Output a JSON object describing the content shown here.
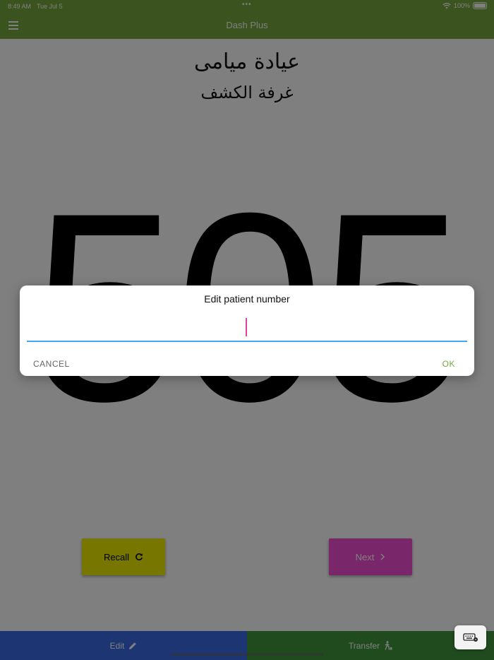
{
  "status_bar": {
    "time": "8:49 AM",
    "date": "Tue Jul 5",
    "dots": "•••",
    "battery": "100%"
  },
  "app_bar": {
    "title": "Dash Plus",
    "menu_icon": "hamburger-menu-icon"
  },
  "main": {
    "clinic_name": "عيادة ميامى",
    "room_name": "غرفة الكشف",
    "patient_number": "505"
  },
  "buttons": {
    "recall_label": "Recall",
    "recall_icon": "refresh-icon",
    "next_label": "Next",
    "next_icon": "chevron-right-icon"
  },
  "bottom_nav": {
    "edit_label": "Edit",
    "edit_icon": "pencil-icon",
    "transfer_label": "Transfer",
    "transfer_icon": "walking-person-icon"
  },
  "dialog": {
    "title": "Edit patient number",
    "input_value": "",
    "cancel_label": "CANCEL",
    "ok_label": "OK"
  },
  "colors": {
    "app_bar": "#76a73d",
    "recall": "#ecec00",
    "next": "#f24dd6",
    "edit_nav": "#3a6ce6",
    "transfer_nav": "#3e963e",
    "input_underline": "#4aa3f0",
    "caret": "#e040a0"
  }
}
